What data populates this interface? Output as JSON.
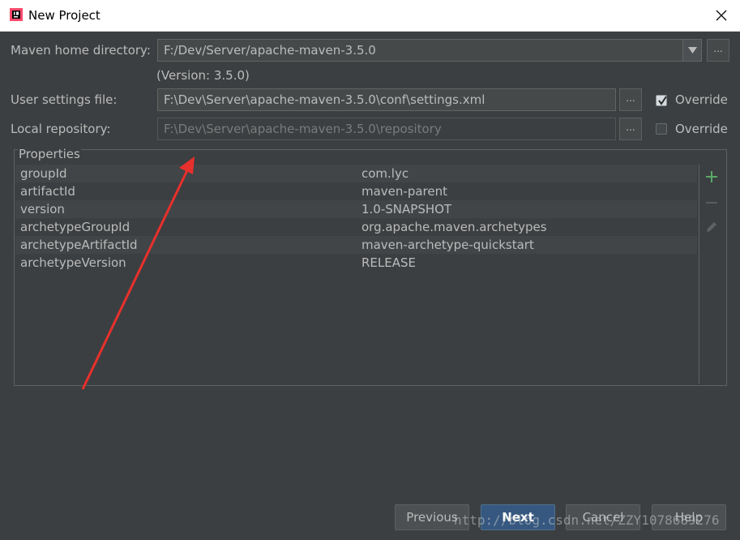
{
  "window": {
    "title": "New Project",
    "close_icon": "close-icon"
  },
  "form": {
    "maven_home_label": "Maven home directory:",
    "maven_home_value": "F:/Dev/Server/apache-maven-3.5.0",
    "version_text": "(Version: 3.5.0)",
    "user_settings_label": "User settings file:",
    "user_settings_value": "F:\\Dev\\Server\\apache-maven-3.5.0\\conf\\settings.xml",
    "local_repo_label": "Local repository:",
    "local_repo_value": "F:\\Dev\\Server\\apache-maven-3.5.0\\repository",
    "browse_label": "...",
    "override_label": "Override",
    "user_settings_override": true,
    "local_repo_override": false
  },
  "properties": {
    "title": "Properties",
    "rows": [
      {
        "key": "groupId",
        "value": "com.lyc"
      },
      {
        "key": "artifactId",
        "value": "maven-parent"
      },
      {
        "key": "version",
        "value": "1.0-SNAPSHOT"
      },
      {
        "key": "archetypeGroupId",
        "value": "org.apache.maven.archetypes"
      },
      {
        "key": "archetypeArtifactId",
        "value": "maven-archetype-quickstart"
      },
      {
        "key": "archetypeVersion",
        "value": "RELEASE"
      }
    ],
    "tools": [
      "add-icon",
      "remove-icon",
      "edit-icon"
    ]
  },
  "buttons": {
    "previous": "Previous",
    "next": "Next",
    "cancel": "Cancel",
    "help": "Help"
  },
  "watermark": "http://blog.csdn.net/ZZY1078689276",
  "colors": {
    "background": "#3c3f41",
    "text": "#bbbbbb",
    "primary_button": "#365880",
    "add_icon": "#59a869",
    "annotation_arrow": "#e8302c"
  }
}
